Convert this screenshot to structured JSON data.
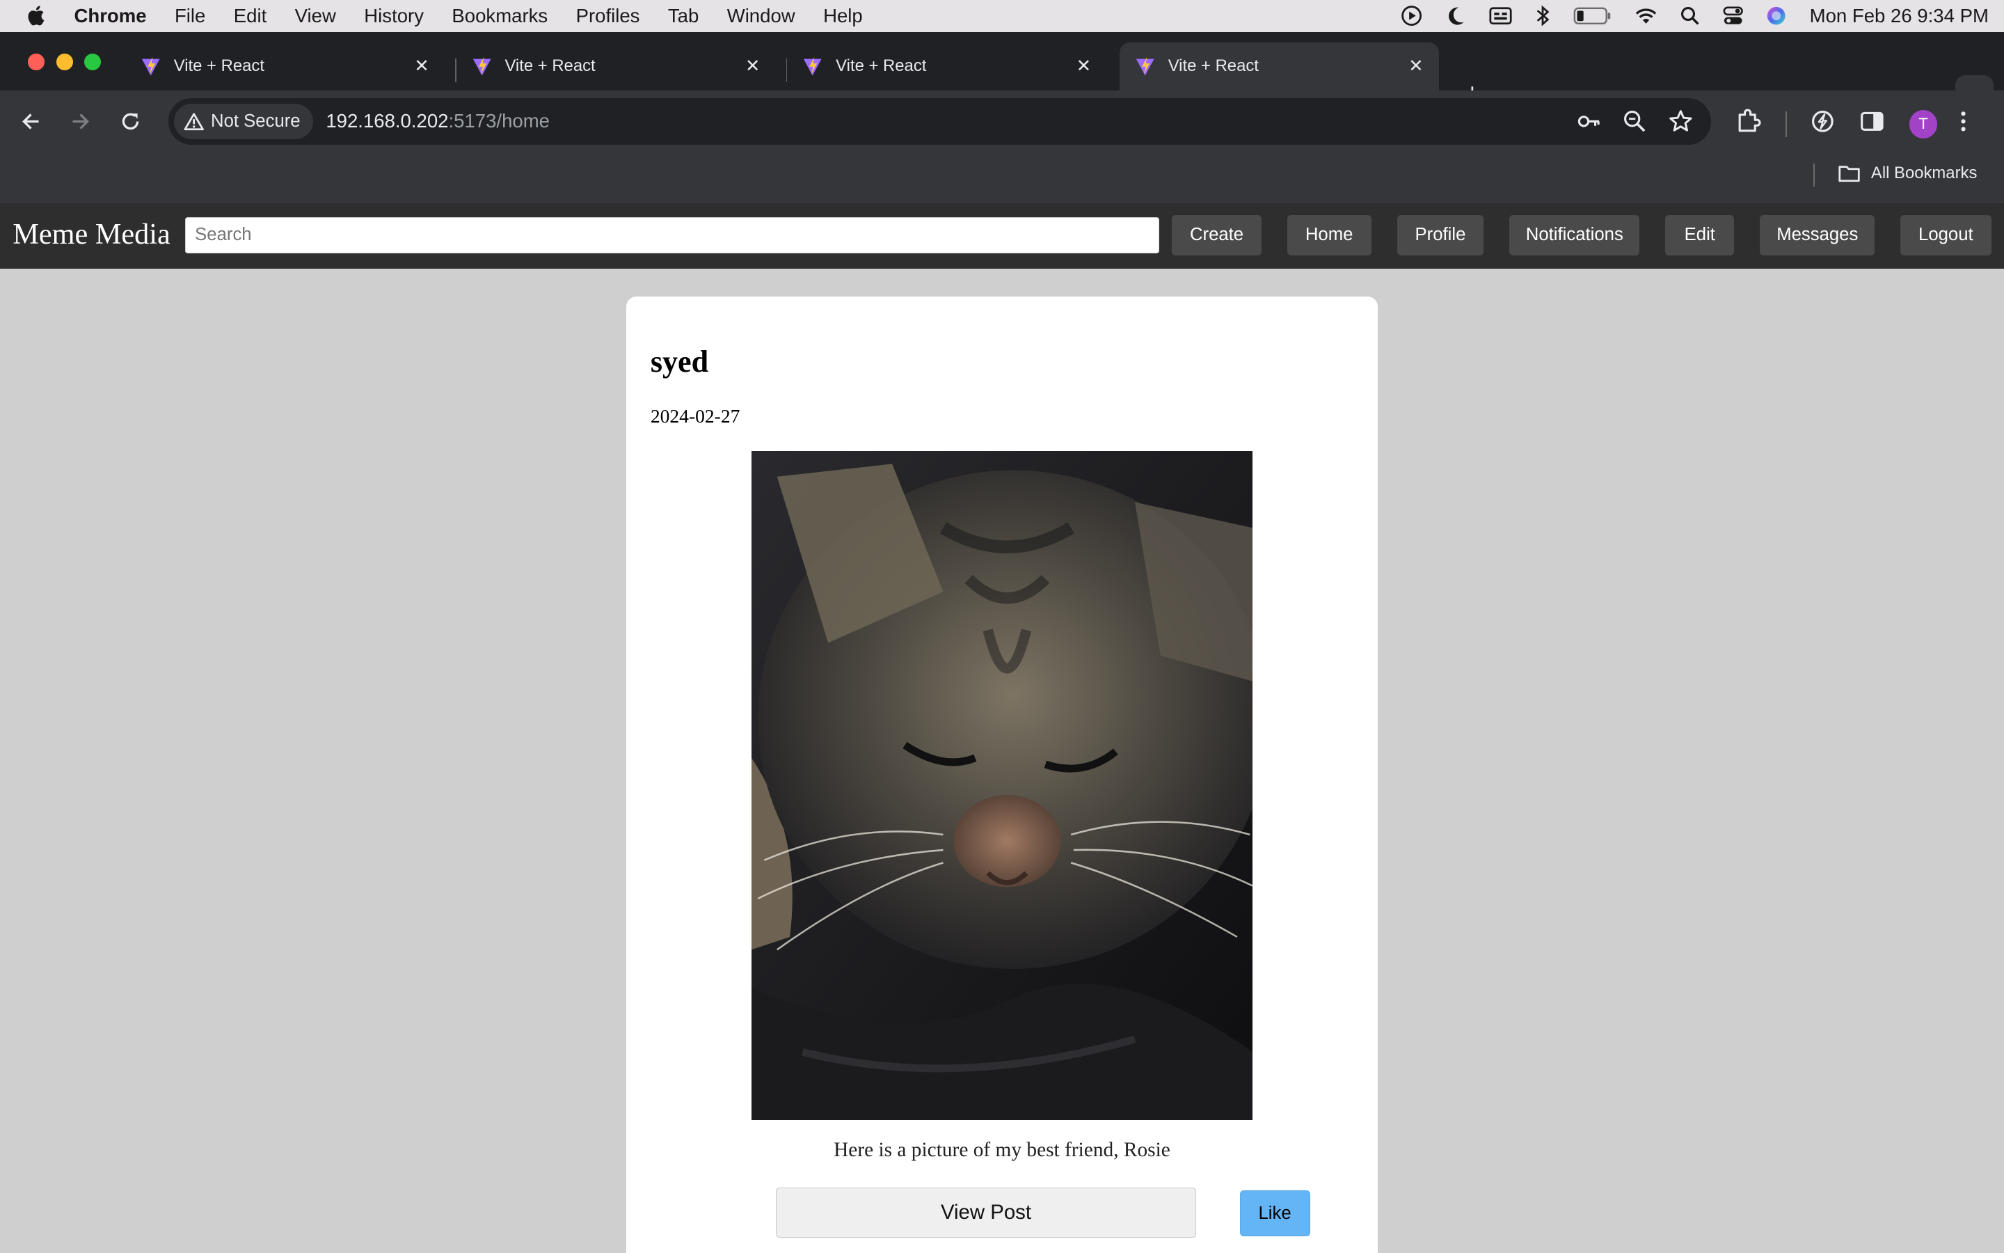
{
  "menubar": {
    "items": [
      "Chrome",
      "File",
      "Edit",
      "View",
      "History",
      "Bookmarks",
      "Profiles",
      "Tab",
      "Window",
      "Help"
    ],
    "clock": "Mon Feb 26  9:34 PM"
  },
  "tabs": [
    {
      "title": "Vite + React"
    },
    {
      "title": "Vite + React"
    },
    {
      "title": "Vite + React"
    },
    {
      "title": "Vite + React"
    }
  ],
  "omnibox": {
    "security": "Not Secure",
    "host": "192.168.0.202",
    "path": ":5173/home"
  },
  "profile_initial": "T",
  "bookmarks": {
    "all": "All Bookmarks"
  },
  "app": {
    "brand": "Meme Media",
    "search_placeholder": "Search",
    "nav": {
      "create": "Create",
      "home": "Home",
      "profile": "Profile",
      "notifications": "Notifications",
      "edit": "Edit",
      "messages": "Messages",
      "logout": "Logout"
    }
  },
  "post": {
    "author": "syed",
    "date": "2024-02-27",
    "caption": "Here is a picture of my best friend, Rosie",
    "view_label": "View Post",
    "like_label": "Like"
  },
  "colors": {
    "nav_bg": "#2e2e2e",
    "nav_button": "#4a4a4a",
    "like_button": "#64b5f6",
    "page_bg": "#cfcfcf"
  }
}
